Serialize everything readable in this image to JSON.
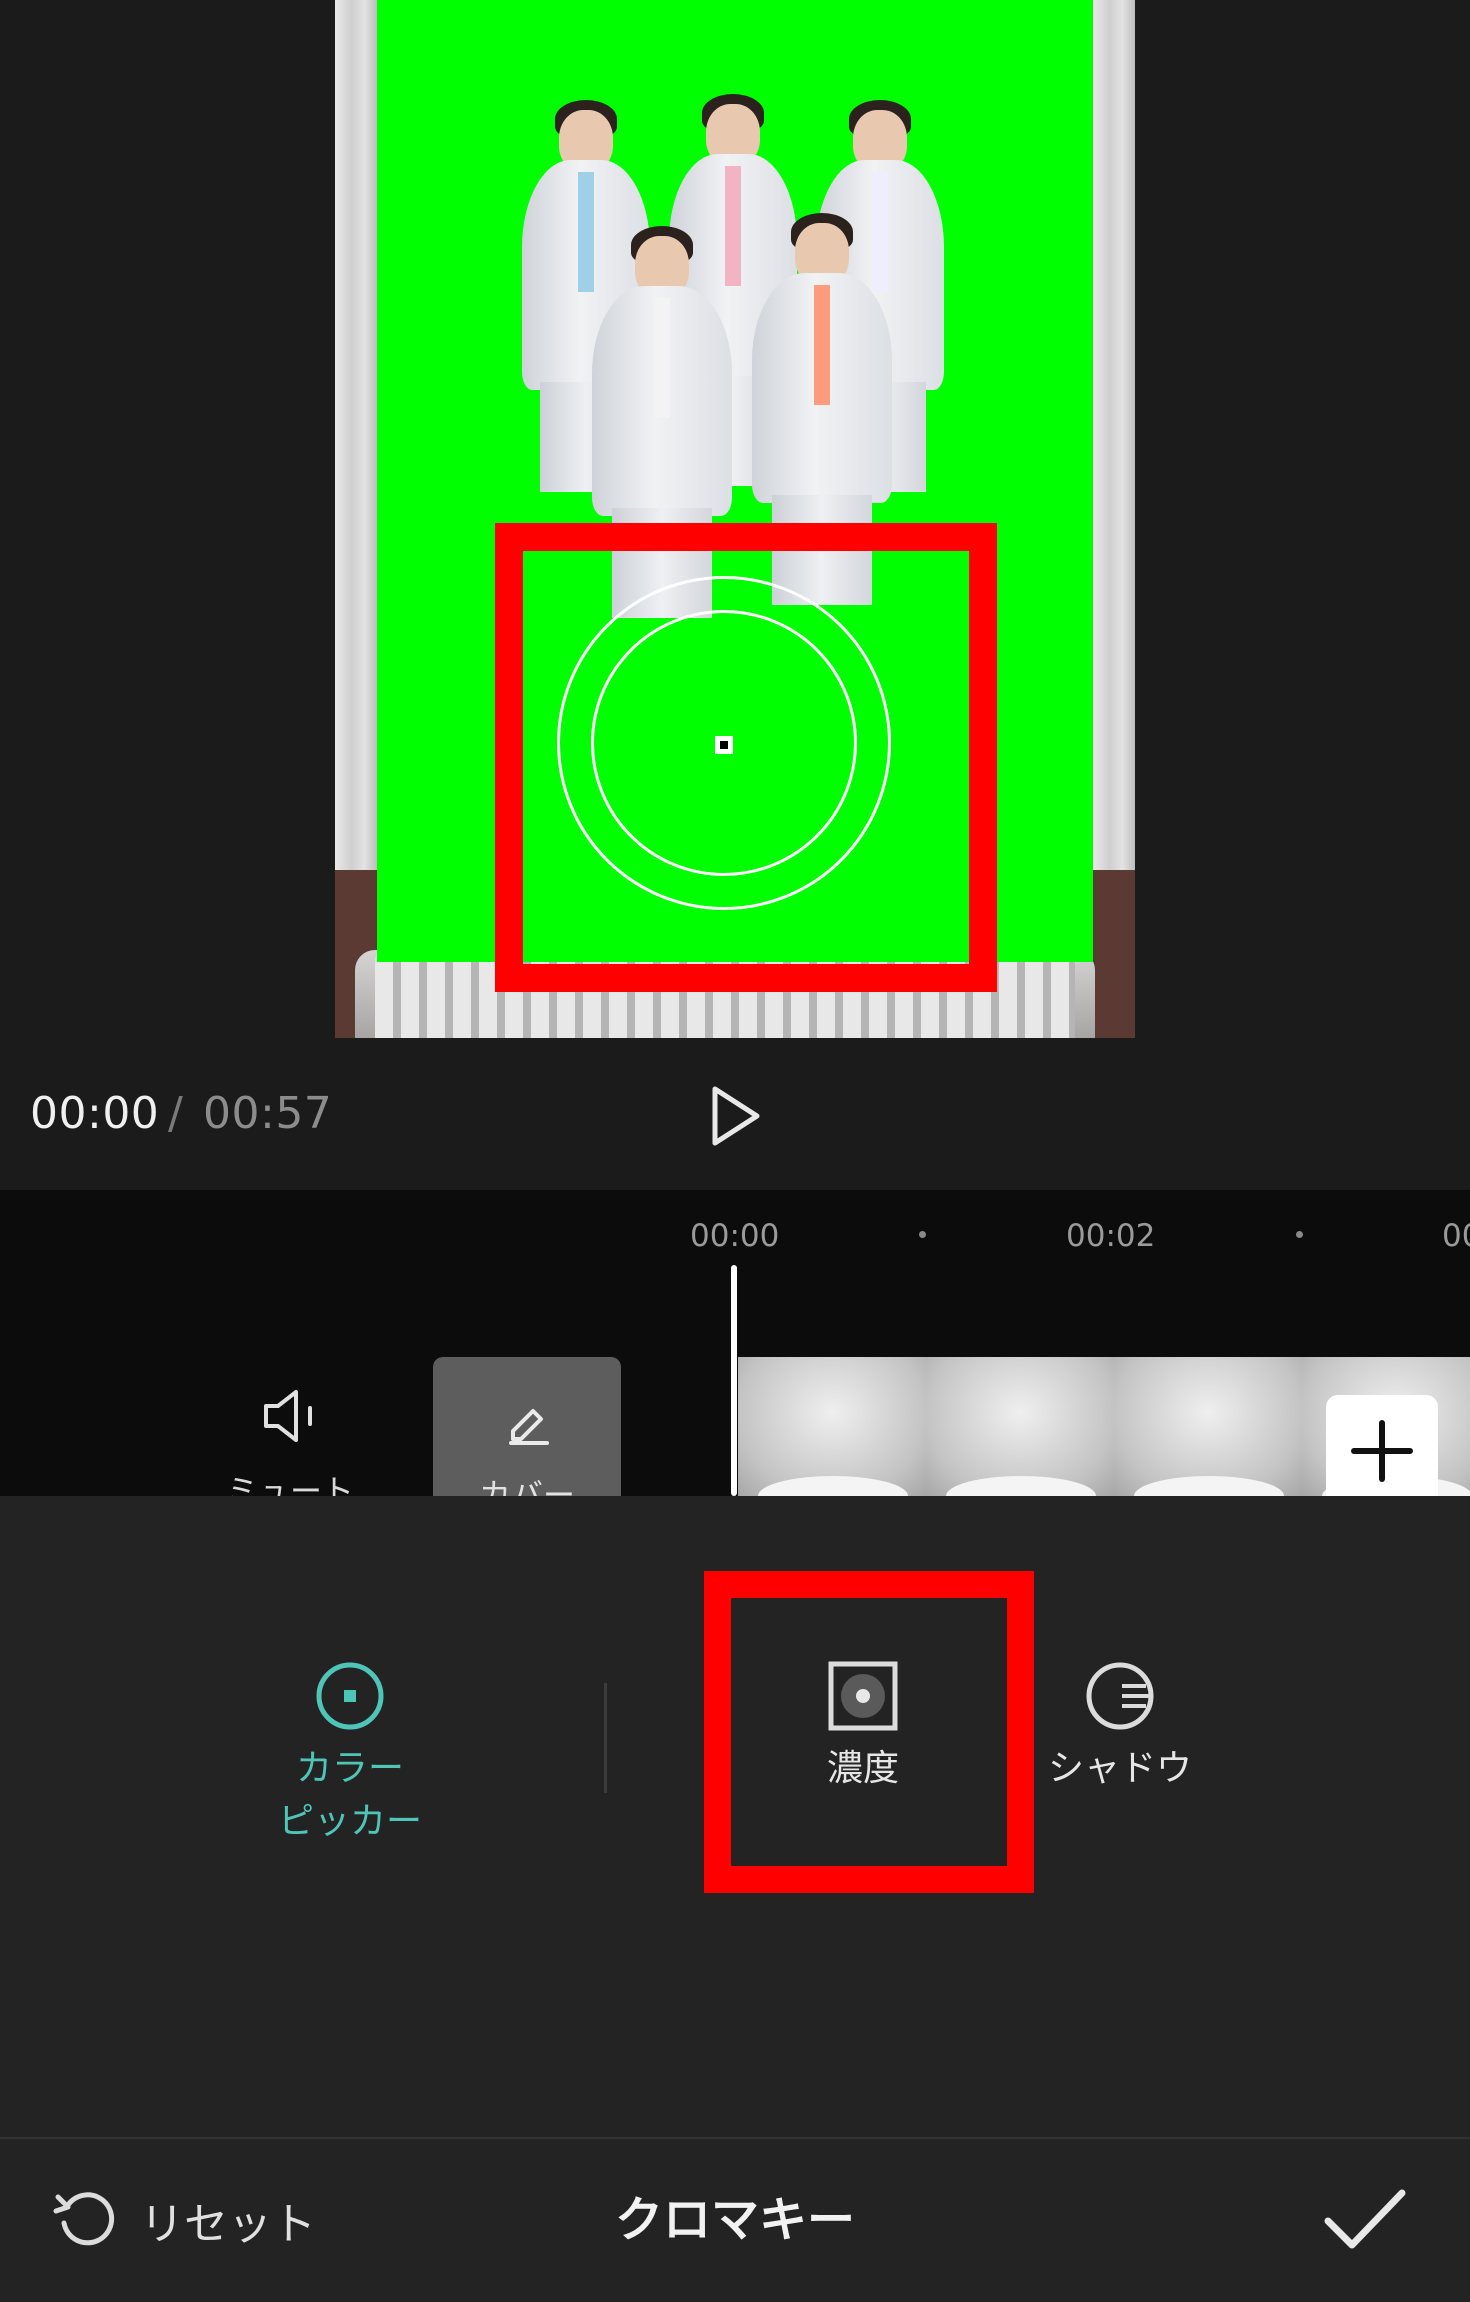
{
  "player": {
    "current_time": "00:00",
    "separator": "/",
    "total_time": "00:57"
  },
  "timeline": {
    "ruler": [
      "00:00",
      "00:02",
      "00"
    ],
    "mute_label": "ミュート",
    "cover_label": "カバー"
  },
  "tools": {
    "color_picker_line1": "カラー",
    "color_picker_line2": "ピッカー",
    "intensity_label": "濃度",
    "shadow_label": "シャドウ"
  },
  "footer": {
    "reset_label": "リセット",
    "title": "クロマキー"
  },
  "colors": {
    "accent_teal": "#4fc5b8",
    "highlight_red": "#ff0000",
    "chroma_green": "#00ff00"
  },
  "icons": [
    "play-icon",
    "speaker-icon",
    "pencil-icon",
    "plus-icon",
    "color-picker-icon",
    "intensity-icon",
    "shadow-icon",
    "reset-icon",
    "check-icon"
  ]
}
